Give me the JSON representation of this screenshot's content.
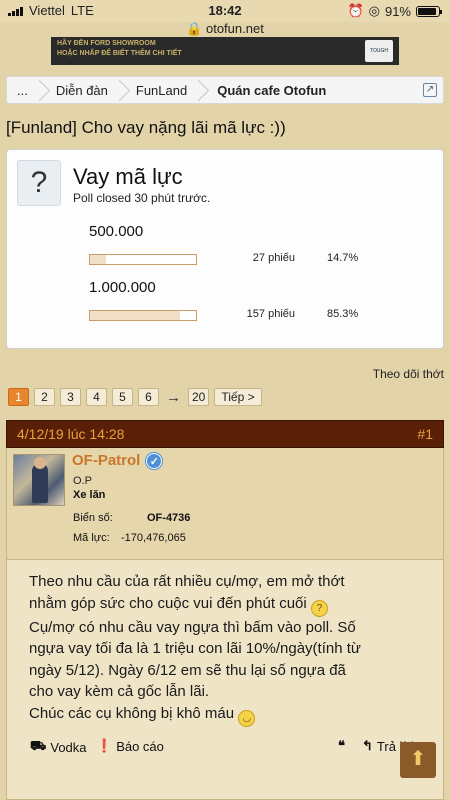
{
  "status_bar": {
    "carrier": "Viettel",
    "network": "LTE",
    "time": "18:42",
    "battery": "91%"
  },
  "browser": {
    "url": "otofun.net"
  },
  "banner": {
    "ad_line1": "HÃY ĐẾN FORD SHOWROOM",
    "ad_line2": "HOẶC NHẤP ĐỂ BIẾT THÊM CHI TIẾT",
    "logo_text": "TOUGH"
  },
  "breadcrumb": {
    "items": [
      "...",
      "Diễn đàn",
      "FunLand"
    ],
    "current": "Quán cafe Otofun"
  },
  "thread": {
    "title": "[Funland] Cho vay nặng lãi mã lực :))"
  },
  "poll": {
    "icon": "?",
    "title": "Vay mã lực",
    "status": "Poll closed 30 phút trước.",
    "options": [
      {
        "label": "500.000",
        "votes": "27 phiếu",
        "percent": "14.7%",
        "share": 0.147
      },
      {
        "label": "1.000.000",
        "votes": "157 phiếu",
        "percent": "85.3%",
        "share": 0.853
      }
    ]
  },
  "follow_label": "Theo dõi thớt",
  "pagination": {
    "pages": [
      "1",
      "2",
      "3",
      "4",
      "5",
      "6"
    ],
    "current": "1",
    "arrow": "→",
    "last": "20",
    "next_label": "Tiếp >"
  },
  "post": {
    "date": "4/12/19 lúc 14:28",
    "number": "#1",
    "username": "OF-Patrol",
    "user_title": "O.P",
    "user_rank": "Xe lăn",
    "plate_label": "Biển số:",
    "plate_value": "OF-4736",
    "power_label": "Mã lực:",
    "power_value": "-170,476,065",
    "body_lines": [
      "Theo nhu cầu của rất nhiều cụ/mợ, em mở thớt",
      "nhằm góp sức cho cuộc vui đến phút cuối",
      "Cụ/mợ có nhu cầu vay ngựa thì bấm vào poll. Số",
      "ngựa vay tối đa là 1 triệu con lãi 10%/ngày(tính từ",
      "ngày 5/12). Ngày 6/12 em sẽ thu lại số ngựa đã",
      "cho vay kèm cả gốc lẫn lãi.",
      "Chúc các cụ không bị khô máu"
    ],
    "actions": {
      "vodka": "Vodka",
      "report": "Báo cáo",
      "reply": "Trả lời"
    }
  },
  "colors": {
    "background": "#e3d3a8",
    "post_header": "#5a1f07",
    "accent": "#e8862e",
    "username": "#c8762a"
  }
}
